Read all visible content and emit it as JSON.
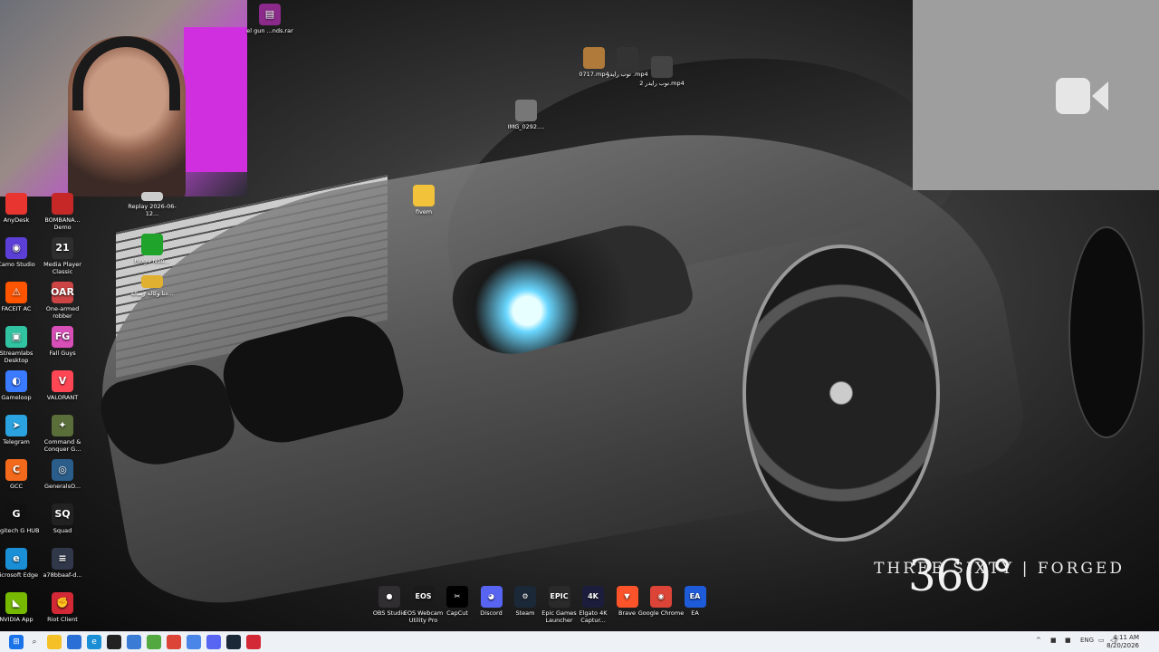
{
  "desktop": {
    "brand_big": "360°",
    "brand_text": "THREE SIXTY | FORGED",
    "left_icons": [
      {
        "label": "AnyDesk",
        "color": "#e8352f",
        "glyph": ""
      },
      {
        "label": "BOMBANA... Demo",
        "color": "#c62828",
        "glyph": ""
      },
      {
        "label": "Camo Studio",
        "color": "#5b3fd6",
        "glyph": "◉"
      },
      {
        "label": "Media Player Classic",
        "color": "#2e2e2e",
        "glyph": "21"
      },
      {
        "label": "FACEIT AC",
        "color": "#ff5500",
        "glyph": "⚠"
      },
      {
        "label": "One-armed robber",
        "color": "#c44",
        "glyph": "OAR"
      },
      {
        "label": "Streamlabs Desktop",
        "color": "#31c3a2",
        "glyph": "▣"
      },
      {
        "label": "Fall Guys",
        "color": "#d84fb8",
        "glyph": "FG"
      },
      {
        "label": "Gameloop",
        "color": "#3a7bff",
        "glyph": "◐"
      },
      {
        "label": "VALORANT",
        "color": "#ff4655",
        "glyph": "V"
      },
      {
        "label": "Telegram",
        "color": "#2aa3e0",
        "glyph": "➤"
      },
      {
        "label": "Command & Conquer G...",
        "color": "#5a6e3a",
        "glyph": "✦"
      },
      {
        "label": "GCC",
        "color": "#f36a1c",
        "glyph": "C"
      },
      {
        "label": "GeneralsO...",
        "color": "#2b5d8a",
        "glyph": "◎"
      },
      {
        "label": "Logitech G HUB",
        "color": "#111",
        "glyph": "G"
      },
      {
        "label": "Squad",
        "color": "#222",
        "glyph": "SQ"
      },
      {
        "label": "Microsoft Edge",
        "color": "#1a8fd6",
        "glyph": "e"
      },
      {
        "label": "a78bbaaf-d...",
        "color": "#30384a",
        "glyph": "≡"
      },
      {
        "label": "NVIDIA App",
        "color": "#76b900",
        "glyph": "◣"
      },
      {
        "label": "Riot Client",
        "color": "#d32936",
        "glyph": "✊"
      }
    ],
    "scattered_icons": {
      "rar": "el gun ...nds.rar",
      "mp4_1": "0717.mp4",
      "mp4_2": "توب رايدر .mp4",
      "mp4_3": "توب رايدر 2.mp4",
      "img": "IMG_0292....",
      "replay": "Replay 2026-06-12...",
      "fivem": "fivem",
      "pingu": "Pingu-Noo...",
      "small_file": "دنا وكاله رسالة..."
    },
    "bottom_icons": [
      {
        "label": "OBS Studio",
        "color": "#302e31",
        "glyph": "●"
      },
      {
        "label": "EOS Webcam Utility Pro",
        "color": "#1a1a1a",
        "glyph": "EOS"
      },
      {
        "label": "CapCut",
        "color": "#000",
        "glyph": "✂"
      },
      {
        "label": "Discord",
        "color": "#5865f2",
        "glyph": "◕"
      },
      {
        "label": "Steam",
        "color": "#1b2838",
        "glyph": "⚙"
      },
      {
        "label": "Epic Games Launcher",
        "color": "#2a2a2a",
        "glyph": "EPIC"
      },
      {
        "label": "Elgato 4K Captur...",
        "color": "#1c1c3c",
        "glyph": "4K"
      },
      {
        "label": "Brave",
        "color": "#fb542b",
        "glyph": "▼"
      },
      {
        "label": "Google Chrome",
        "color": "#db4437",
        "glyph": "◉"
      },
      {
        "label": "EA",
        "color": "#1e5bd8",
        "glyph": "EA"
      }
    ]
  },
  "taskbar": {
    "language": "ENG",
    "time": "4:11 AM",
    "date": "8/20/2026"
  }
}
